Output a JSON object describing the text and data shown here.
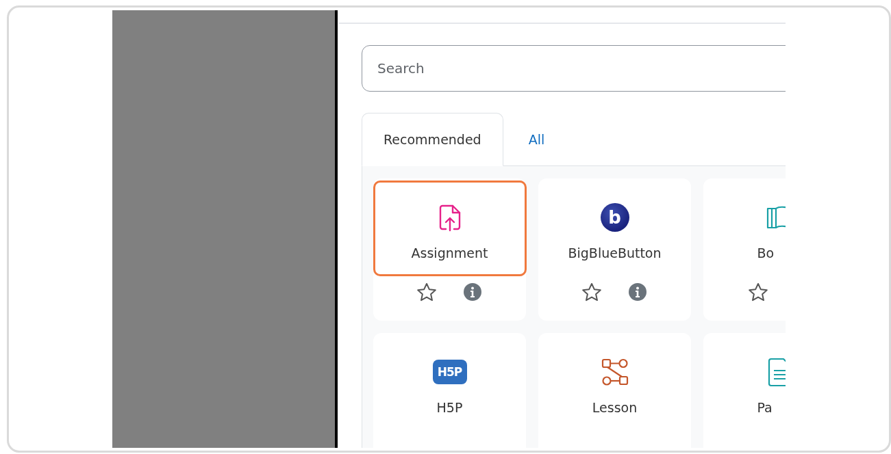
{
  "search": {
    "placeholder": "Search"
  },
  "tabs": [
    {
      "label": "Recommended",
      "selected": true
    },
    {
      "label": "All",
      "selected": false
    }
  ],
  "cards": [
    {
      "kind": "assignment",
      "label": "Assignment",
      "highlighted": true,
      "info": true
    },
    {
      "kind": "bigbluebutton",
      "label": "BigBlueButton",
      "logo": "b",
      "highlighted": false,
      "info": true
    },
    {
      "kind": "book",
      "label": "Bo",
      "highlighted": false,
      "info": false
    },
    {
      "kind": "h5p",
      "label": "H5P",
      "logo": "H5P",
      "highlighted": false
    },
    {
      "kind": "lesson",
      "label": "Lesson",
      "highlighted": false
    },
    {
      "kind": "page",
      "label": "Pa",
      "highlighted": false
    }
  ]
}
